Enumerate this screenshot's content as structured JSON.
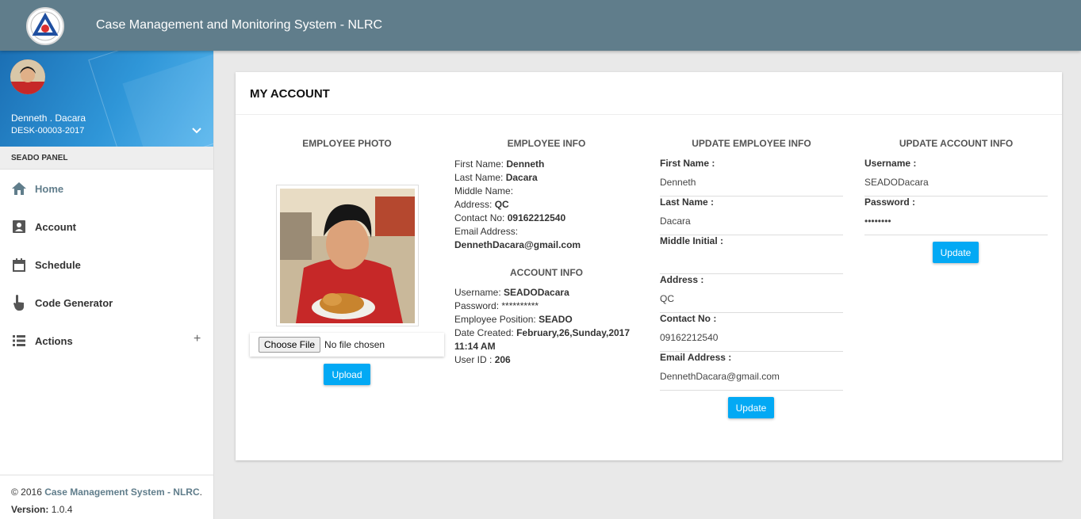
{
  "header": {
    "title": "Case Management and Monitoring System - NLRC"
  },
  "sidebar": {
    "user_name": "Denneth . Dacara",
    "user_id": "DESK-00003-2017",
    "panel_label": "SEADO PANEL",
    "items": [
      {
        "label": "Home",
        "icon": "home-icon"
      },
      {
        "label": "Account",
        "icon": "account-box-icon"
      },
      {
        "label": "Schedule",
        "icon": "calendar-icon"
      },
      {
        "label": "Code Generator",
        "icon": "touch-hand-icon"
      },
      {
        "label": "Actions",
        "icon": "list-icon",
        "expand": "+"
      }
    ],
    "footer": {
      "copyright_prefix": "© 2016",
      "brand": "Case Management System - NLRC",
      "suffix": ".",
      "version_label": "Version:",
      "version": "1.0.4"
    }
  },
  "card": {
    "title": "MY ACCOUNT",
    "photo": {
      "title": "EMPLOYEE PHOTO",
      "choose_file": "Choose File",
      "no_file": "No file chosen",
      "upload": "Upload"
    },
    "employee_info": {
      "title": "EMPLOYEE INFO",
      "first_name_label": "First Name:",
      "first_name": "Denneth",
      "last_name_label": "Last Name:",
      "last_name": "Dacara",
      "middle_name_label": "Middle Name:",
      "middle_name": "",
      "address_label": "Address:",
      "address": "QC",
      "contact_label": "Contact No:",
      "contact": "09162212540",
      "email_label": "Email Address:",
      "email": "DennethDacara@gmail.com"
    },
    "account_info": {
      "title": "ACCOUNT INFO",
      "username_label": "Username:",
      "username": "SEADODacara",
      "password_label": "Password:",
      "password": "**********",
      "position_label": "Employee Position:",
      "position": "SEADO",
      "date_label": "Date Created:",
      "date": "February,26,Sunday,2017",
      "time": "11:14 AM",
      "userid_label": "User ID :",
      "userid": "206"
    },
    "update_employee": {
      "title": "UPDATE EMPLOYEE INFO",
      "fields": [
        {
          "label": "First Name :",
          "value": "Denneth"
        },
        {
          "label": "Last Name :",
          "value": "Dacara"
        },
        {
          "label": "Middle Initial :",
          "value": ""
        },
        {
          "label": "Address :",
          "value": "QC"
        },
        {
          "label": "Contact No :",
          "value": "09162212540"
        },
        {
          "label": "Email Address :",
          "value": "DennethDacara@gmail.com"
        }
      ],
      "button": "Update"
    },
    "update_account": {
      "title": "UPDATE ACCOUNT INFO",
      "fields": [
        {
          "label": "Username :",
          "value": "SEADODacara"
        },
        {
          "label": "Password :",
          "value": "••••••••"
        }
      ],
      "button": "Update"
    }
  },
  "colors": {
    "topbar": "#607d8b",
    "accent_button": "#03a9f4",
    "sidebar_gradient": "#2f96d8"
  }
}
